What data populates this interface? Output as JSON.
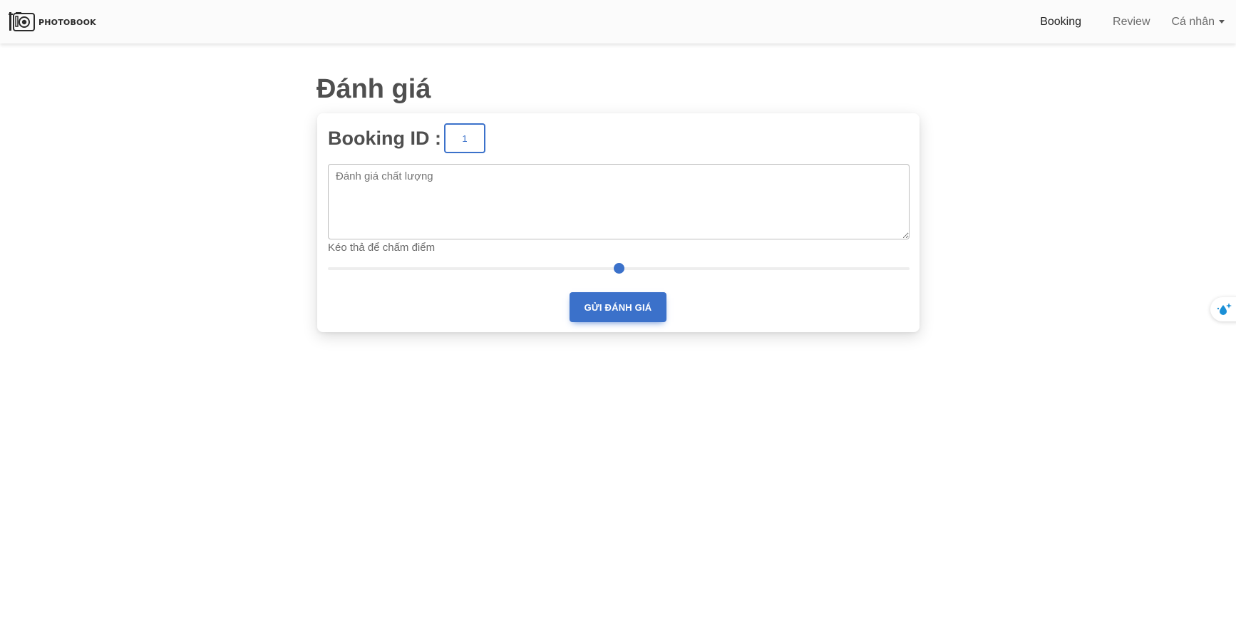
{
  "navbar": {
    "brand_text": "PHOTOBOOK",
    "links": {
      "booking": "Booking",
      "review": "Review",
      "personal": "Cá nhân"
    }
  },
  "page": {
    "title": "Đánh giá"
  },
  "form": {
    "booking_id_label": "Booking ID :",
    "booking_id_value": "1",
    "review_placeholder": "Đánh giá chất lượng",
    "review_value": "",
    "slider_label": "Kéo thả để chấm điểm",
    "slider_value_fraction": 0.5,
    "submit_label": "GỬI ĐÁNH GIÁ"
  },
  "colors": {
    "primary": "#3b71ca",
    "navbar_bg": "#fbfbfb",
    "text": "#4f4f4f"
  },
  "icons": {
    "brand": "camera-logo-icon",
    "dropdown": "caret-down-icon",
    "widget": "drop-sparkle-icon"
  }
}
